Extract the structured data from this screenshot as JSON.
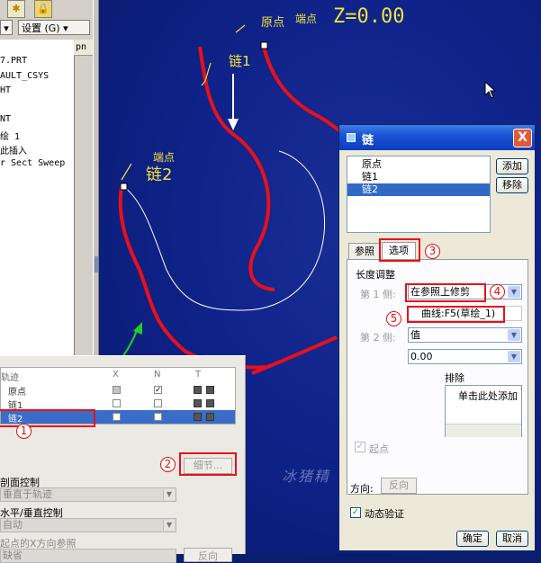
{
  "toolbar": {
    "settings_label": "设置 (G)",
    "star_icon": "star-icon",
    "lock_icon": "lock-icon"
  },
  "model_tree": {
    "col_header": "pn",
    "items": [
      "7.PRT",
      "AULT_CSYS",
      "HT",
      "",
      "NT",
      "绘 1",
      "此插入",
      "r Sect Sweep"
    ]
  },
  "viewport": {
    "origin_label": "原点",
    "endpoint_label": "端点",
    "z_readout": "Z=0.00",
    "chain1_label": "链1",
    "endpoint2_label": "端点",
    "chain2_label": "链2",
    "watermark": "冰猪精",
    "colors": {
      "background": "#0f238a",
      "curve": "#e8101a",
      "label": "#f2e23a"
    }
  },
  "sweep_panel": {
    "trajectory_header": "轨迹",
    "columns": [
      "X",
      "N",
      "T"
    ],
    "rows": [
      {
        "name": "原点",
        "x": true,
        "n": true
      },
      {
        "name": "链1",
        "x": false,
        "n": false
      },
      {
        "name": "链2",
        "x": false,
        "n": false,
        "selected": true
      }
    ],
    "detail_button": "细节...",
    "section_control_label": "剖面控制",
    "section_control_value": "垂直于轨迹",
    "horiz_vert_label": "水平/垂直控制",
    "horiz_vert_value": "自动",
    "start_x_label": "起点的X方向参照",
    "start_x_value": "缺省",
    "flip_button": "反向"
  },
  "dialog": {
    "title": "链",
    "close_label": "X",
    "references": [
      "原点",
      "链1",
      "链2"
    ],
    "selected_index": 2,
    "add_button": "添加",
    "remove_button": "移除",
    "tabs": [
      "参照",
      "选项"
    ],
    "active_tab": "选项",
    "length_adjust_label": "长度调整",
    "side1_label": "第 1 侧:",
    "side1_value": "在参照上修剪",
    "curve_value": "曲线:F5(草绘_1)",
    "side2_label": "第 2 侧:",
    "side2_value": "值",
    "side2_number": "0.00",
    "exclude_label": "排除",
    "exclude_placeholder": "单击此处添加",
    "start_point_label": "起点",
    "direction_label": "方向:",
    "flip_button": "反向",
    "dynamic_verify_label": "动态验证",
    "ok_button": "确定",
    "cancel_button": "取消"
  },
  "annotations": [
    "1",
    "2",
    "3",
    "4",
    "5"
  ]
}
